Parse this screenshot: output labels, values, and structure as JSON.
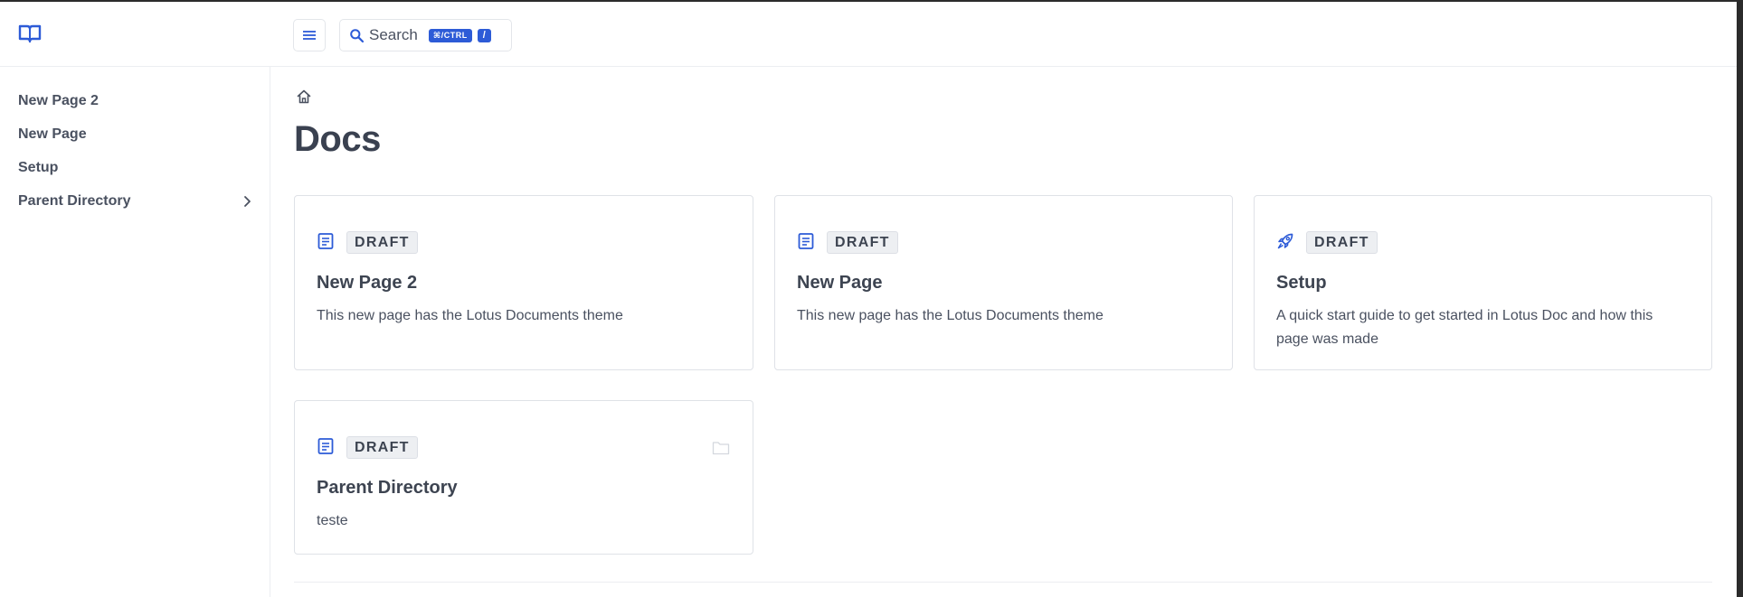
{
  "header": {
    "logo_icon": "book-open-icon",
    "menu_icon": "hamburger-menu-icon",
    "search": {
      "icon": "search-icon",
      "label": "Search",
      "shortcut_modifier": "⌘/CTRL",
      "shortcut_key": "/"
    }
  },
  "sidebar": {
    "items": [
      {
        "label": "New Page 2"
      },
      {
        "label": "New Page"
      },
      {
        "label": "Setup"
      },
      {
        "label": "Parent Directory",
        "icon": "chevron-right-icon"
      }
    ]
  },
  "main": {
    "breadcrumb_icon": "home-icon",
    "title": "Docs",
    "cards": [
      {
        "icon": "document-icon",
        "badge": "DRAFT",
        "title": "New Page 2",
        "description": "This new page has the Lotus Documents theme"
      },
      {
        "icon": "document-icon",
        "badge": "DRAFT",
        "title": "New Page",
        "description": "This new page has the Lotus Documents theme"
      },
      {
        "icon": "rocket-icon",
        "badge": "DRAFT",
        "title": "Setup",
        "description": "A quick start guide to get started in Lotus Doc and how this page was made"
      },
      {
        "icon": "document-icon",
        "badge": "DRAFT",
        "title": "Parent Directory",
        "description": "teste",
        "extra_icon": "folder-icon"
      }
    ]
  },
  "colors": {
    "accent": "#2d5bd7",
    "text": "#3d4451",
    "border": "#dfe2e7",
    "badge_bg": "#edeff2"
  }
}
